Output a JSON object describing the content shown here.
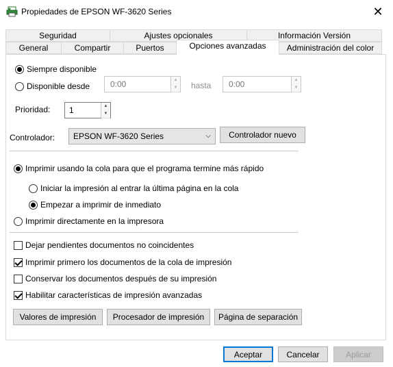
{
  "window": {
    "title": "Propiedades de EPSON WF-3620 Series"
  },
  "tabs_row1": [
    {
      "label": "Seguridad"
    },
    {
      "label": "Ajustes opcionales"
    },
    {
      "label": "Información Versión"
    }
  ],
  "tabs_row2": [
    {
      "label": "General"
    },
    {
      "label": "Compartir"
    },
    {
      "label": "Puertos"
    },
    {
      "label": "Opciones avanzadas"
    },
    {
      "label": "Administración del color"
    }
  ],
  "availability": {
    "always_label": "Siempre disponible",
    "from_label": "Disponible desde",
    "from_value": "0:00",
    "until_label": "hasta",
    "until_value": "0:00"
  },
  "priority": {
    "label": "Prioridad:",
    "value": "1"
  },
  "driver": {
    "label": "Controlador:",
    "selected": "EPSON WF-3620 Series",
    "new_button": "Controlador nuevo"
  },
  "spool": {
    "spool_label": "Imprimir usando la cola para que el programa termine más rápido",
    "start_after_last_label": "Iniciar la impresión al entrar la última página en la cola",
    "start_immediately_label": "Empezar a imprimir de inmediato",
    "direct_label": "Imprimir directamente en la impresora"
  },
  "options": [
    {
      "label": "Dejar pendientes documentos no coincidentes",
      "checked": false
    },
    {
      "label": "Imprimir primero los documentos de la cola de impresión",
      "checked": true
    },
    {
      "label": "Conservar los documentos después de su impresión",
      "checked": false
    },
    {
      "label": "Habilitar características de impresión avanzadas",
      "checked": true
    }
  ],
  "bottom_buttons": {
    "defaults": "Valores de impresión",
    "processor": "Procesador de impresión",
    "separator": "Página de separación"
  },
  "dialog_buttons": {
    "ok": "Aceptar",
    "cancel": "Cancelar",
    "apply": "Aplicar"
  }
}
